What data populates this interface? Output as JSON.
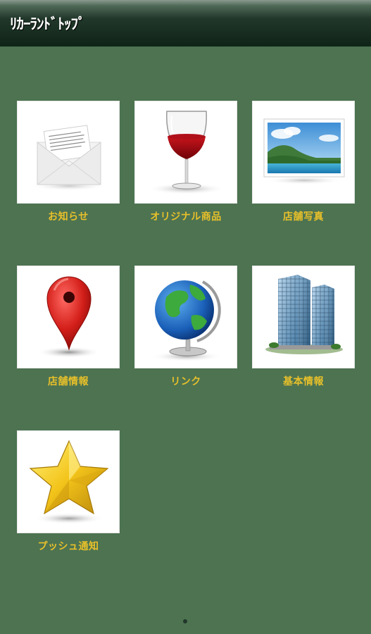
{
  "header": {
    "title": "ﾘｶｰﾗﾝﾄﾞﾄｯﾌﾟ"
  },
  "tiles": [
    {
      "label": "お知らせ",
      "icon": "envelope-icon"
    },
    {
      "label": "オリジナル商品",
      "icon": "wine-glass-icon"
    },
    {
      "label": "店舗写真",
      "icon": "landscape-photo-icon"
    },
    {
      "label": "店舗情報",
      "icon": "map-pin-icon"
    },
    {
      "label": "リンク",
      "icon": "globe-icon"
    },
    {
      "label": "基本情報",
      "icon": "building-icon"
    },
    {
      "label": "プッシュ通知",
      "icon": "star-icon"
    }
  ],
  "colors": {
    "background": "#4d7351",
    "header": "#0f2417",
    "label": "#e8c02a"
  }
}
